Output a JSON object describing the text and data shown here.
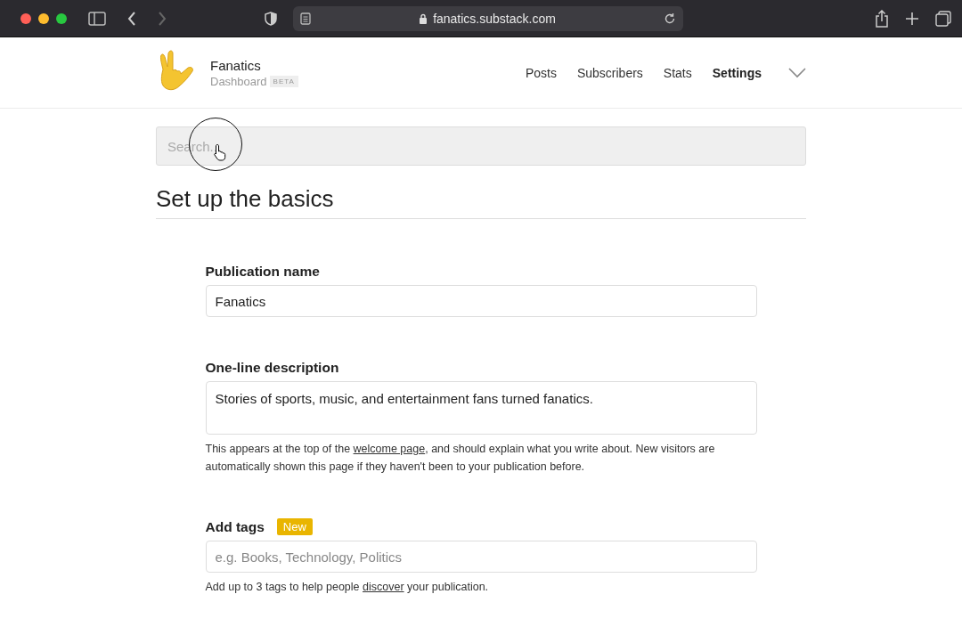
{
  "browser": {
    "url": "fanatics.substack.com"
  },
  "header": {
    "publication": "Fanatics",
    "subtitle": "Dashboard",
    "badge": "BETA",
    "nav": [
      {
        "label": "Posts",
        "selected": false
      },
      {
        "label": "Subscribers",
        "selected": false
      },
      {
        "label": "Stats",
        "selected": false
      },
      {
        "label": "Settings",
        "selected": true
      }
    ]
  },
  "search": {
    "placeholder": "Search..."
  },
  "section_title": "Set up the basics",
  "fields": [
    {
      "kind": "input",
      "label": "Publication name",
      "value": "Fanatics"
    },
    {
      "kind": "textarea",
      "label": "One-line description",
      "value": "Stories of sports, music, and entertainment fans turned fanatics.",
      "help": [
        {
          "text": "This appears at the top of the "
        },
        {
          "link": "welcome page"
        },
        {
          "text": ", and should explain what you write about. New visitors are automatically shown this page if they haven't been to your publication before."
        }
      ]
    },
    {
      "kind": "input",
      "label": "Add tags",
      "badge": "New",
      "placeholder": "e.g. Books, Technology, Politics",
      "help": [
        {
          "text": "Add up to 3 tags to help people "
        },
        {
          "link": "discover"
        },
        {
          "text": " your publication."
        }
      ]
    }
  ]
}
